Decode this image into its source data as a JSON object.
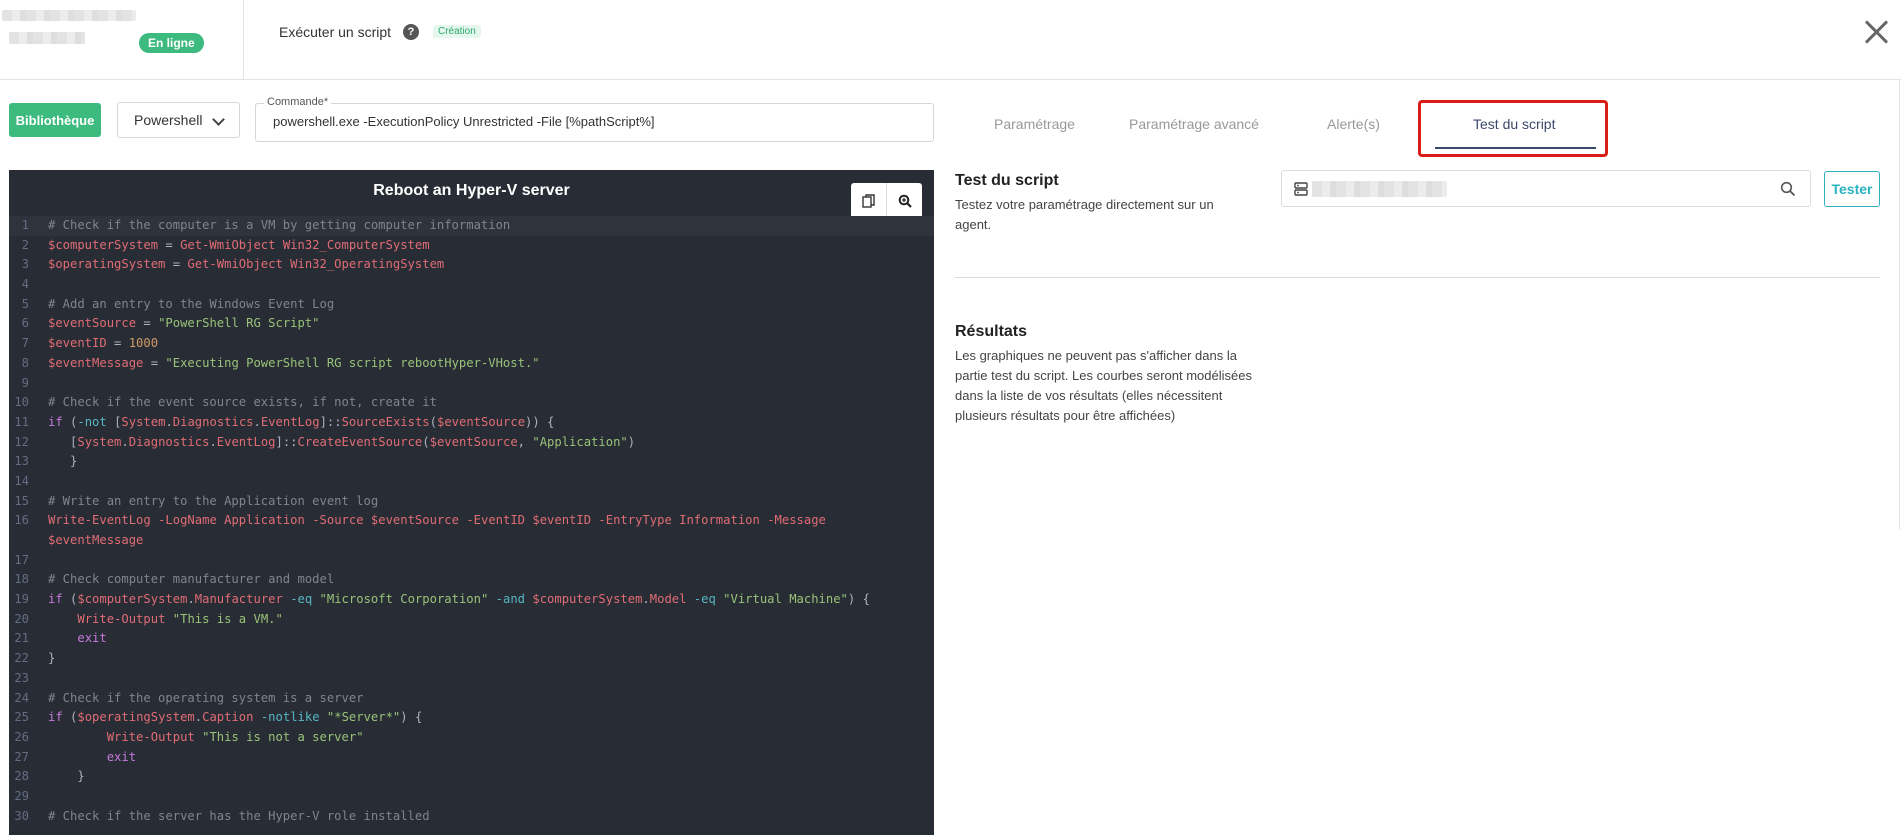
{
  "header": {
    "status_badge": "En ligne",
    "title": "Exécuter un script",
    "help_icon": "help-circle-icon",
    "mode_badge": "Création",
    "close_icon": "close-icon"
  },
  "toolbar": {
    "library_button": "Bibliothèque",
    "language_select": "Powershell",
    "command_label": "Commande*",
    "command_value": "powershell.exe -ExecutionPolicy Unrestricted -File [%pathScript%]"
  },
  "editor": {
    "title": "Reboot an Hyper-V server",
    "tools": [
      "copy-icon",
      "zoom-in-icon"
    ],
    "lines": [
      {
        "n": "1",
        "t": "# Check if the computer is a VM by getting computer information"
      },
      {
        "n": "2",
        "t": "$computerSystem = Get-WmiObject Win32_ComputerSystem"
      },
      {
        "n": "3",
        "t": "$operatingSystem = Get-WmiObject Win32_OperatingSystem"
      },
      {
        "n": "4",
        "t": ""
      },
      {
        "n": "5",
        "t": "# Add an entry to the Windows Event Log"
      },
      {
        "n": "6",
        "t": "$eventSource = \"PowerShell RG Script\""
      },
      {
        "n": "7",
        "t": "$eventID = 1000"
      },
      {
        "n": "8",
        "t": "$eventMessage = \"Executing PowerShell RG script rebootHyper-VHost.\""
      },
      {
        "n": "9",
        "t": ""
      },
      {
        "n": "10",
        "t": "# Check if the event source exists, if not, create it"
      },
      {
        "n": "11",
        "t": "if (-not [System.Diagnostics.EventLog]::SourceExists($eventSource)) {"
      },
      {
        "n": "12",
        "t": "   [System.Diagnostics.EventLog]::CreateEventSource($eventSource, \"Application\")"
      },
      {
        "n": "13",
        "t": "   }"
      },
      {
        "n": "14",
        "t": ""
      },
      {
        "n": "15",
        "t": "# Write an entry to the Application event log"
      },
      {
        "n": "16",
        "t": "Write-EventLog -LogName Application -Source $eventSource -EventID $eventID -EntryType Information -Message"
      },
      {
        "n": "",
        "t": "$eventMessage"
      },
      {
        "n": "17",
        "t": ""
      },
      {
        "n": "18",
        "t": "# Check computer manufacturer and model"
      },
      {
        "n": "19",
        "t": "if ($computerSystem.Manufacturer -eq \"Microsoft Corporation\" -and $computerSystem.Model -eq \"Virtual Machine\") {"
      },
      {
        "n": "20",
        "t": "    Write-Output \"This is a VM.\""
      },
      {
        "n": "21",
        "t": "    exit"
      },
      {
        "n": "22",
        "t": "}"
      },
      {
        "n": "23",
        "t": ""
      },
      {
        "n": "24",
        "t": "# Check if the operating system is a server"
      },
      {
        "n": "25",
        "t": "if ($operatingSystem.Caption -notlike \"*Server*\") {"
      },
      {
        "n": "26",
        "t": "        Write-Output \"This is not a server\""
      },
      {
        "n": "27",
        "t": "        exit"
      },
      {
        "n": "28",
        "t": "    }"
      },
      {
        "n": "29",
        "t": ""
      },
      {
        "n": "30",
        "t": "# Check if the server has the Hyper-V role installed"
      }
    ]
  },
  "tabs": [
    {
      "label": "Paramétrage"
    },
    {
      "label": "Paramétrage avancé"
    },
    {
      "label": "Alerte(s)"
    },
    {
      "label": "Test du script",
      "active": true
    }
  ],
  "test_section": {
    "title": "Test du script",
    "description": "Testez votre paramétrage directement sur un agent.",
    "agent_icon": "server-icon",
    "search_icon": "search-icon",
    "test_button": "Tester"
  },
  "results_section": {
    "title": "Résultats",
    "description": "Les graphiques ne peuvent pas s'afficher dans la partie test du script. Les courbes seront modélisées dans la liste de vos résultats (elles nécessitent plusieurs résultats pour être affichées)"
  },
  "colors": {
    "green": "#3dbb7f",
    "editor_bg": "#282c34",
    "tab_active": "#3b4a6b",
    "highlight_red": "#d91e18",
    "tester": "#2bb3c0"
  }
}
